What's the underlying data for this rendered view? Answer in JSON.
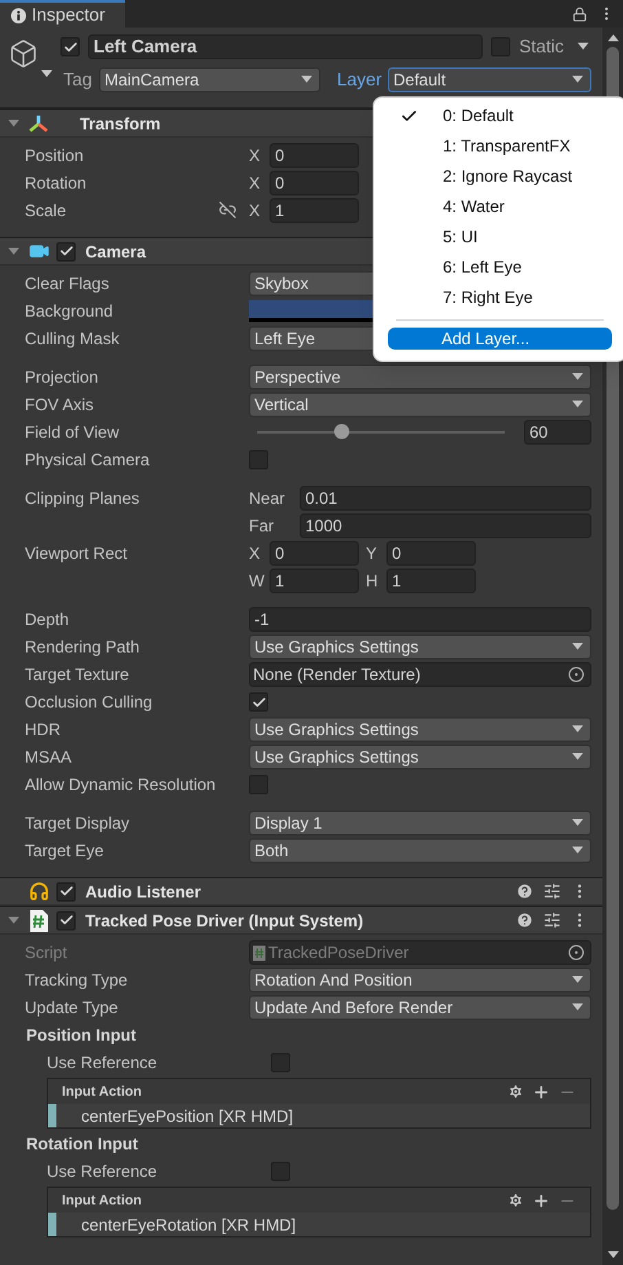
{
  "tab": {
    "title": "Inspector"
  },
  "object": {
    "active": true,
    "name": "Left Camera",
    "static": {
      "label": "Static",
      "checked": false
    },
    "tag": {
      "label": "Tag",
      "value": "MainCamera"
    },
    "layer": {
      "label": "Layer",
      "value": "Default"
    }
  },
  "components": [
    {
      "title": "Transform",
      "kind": "transform",
      "expanded": true,
      "tools": false,
      "groups": [
        [
          {
            "kind": "vector",
            "label": "Position",
            "axis": "X",
            "value": "0"
          },
          {
            "kind": "vector",
            "label": "Rotation",
            "axis": "X",
            "value": "0"
          },
          {
            "kind": "scale",
            "label": "Scale",
            "axis": "X",
            "value": "1"
          }
        ]
      ]
    },
    {
      "title": "Camera",
      "kind": "camera",
      "enabled": true,
      "expanded": true,
      "tools": false,
      "groups": [
        [
          {
            "kind": "partial_dropdown",
            "label": "Clear Flags",
            "value": "Skybox"
          },
          {
            "kind": "color",
            "label": "Background",
            "color": "#2f4b7c"
          },
          {
            "kind": "partial_dropdown",
            "label": "Culling Mask",
            "value": "Left Eye"
          }
        ],
        [
          {
            "kind": "dropdown",
            "label": "Projection",
            "value": "Perspective"
          },
          {
            "kind": "dropdown",
            "label": "FOV Axis",
            "value": "Vertical"
          },
          {
            "kind": "slider",
            "label": "Field of View",
            "level": 0.34,
            "value": "60"
          },
          {
            "kind": "checkbox",
            "label": "Physical Camera",
            "checked": false
          }
        ],
        [
          {
            "kind": "planes",
            "label": "Clipping Planes",
            "near_label": "Near",
            "near": "0.01",
            "far_label": "Far",
            "far": "1000"
          },
          {
            "kind": "rect",
            "label": "Viewport Rect",
            "fields": [
              {
                "label": "X",
                "value": "0"
              },
              {
                "label": "Y",
                "value": "0"
              },
              {
                "label": "W",
                "value": "1"
              },
              {
                "label": "H",
                "value": "1"
              }
            ]
          }
        ],
        [
          {
            "kind": "field",
            "label": "Depth",
            "value": "-1"
          },
          {
            "kind": "dropdown",
            "label": "Rendering Path",
            "value": "Use Graphics Settings"
          },
          {
            "kind": "object",
            "label": "Target Texture",
            "value": "None (Render Texture)",
            "disabled": false
          },
          {
            "kind": "checkbox",
            "label": "Occlusion Culling",
            "checked": true
          },
          {
            "kind": "dropdown",
            "label": "HDR",
            "value": "Use Graphics Settings"
          },
          {
            "kind": "dropdown",
            "label": "MSAA",
            "value": "Use Graphics Settings"
          },
          {
            "kind": "checkbox",
            "label": "Allow Dynamic Resolution",
            "checked": false
          }
        ],
        [
          {
            "kind": "dropdown",
            "label": "Target Display",
            "value": "Display 1"
          },
          {
            "kind": "dropdown",
            "label": "Target Eye",
            "value": "Both"
          }
        ]
      ]
    },
    {
      "title": "Audio Listener",
      "kind": "audio",
      "enabled": true,
      "tools": true
    },
    {
      "title": "Tracked Pose Driver (Input System)",
      "kind": "script",
      "enabled": true,
      "expanded": true,
      "tools": true,
      "groups": [
        [
          {
            "kind": "object",
            "label": "Script",
            "value": "TrackedPoseDriver",
            "disabled": true
          },
          {
            "kind": "dropdown",
            "label": "Tracking Type",
            "value": "Rotation And Position"
          },
          {
            "kind": "dropdown",
            "label": "Update Type",
            "value": "Update And Before Render"
          },
          {
            "kind": "section",
            "label": "Position Input"
          },
          {
            "kind": "subcheckbox",
            "label": "Use Reference",
            "checked": false
          },
          {
            "kind": "action",
            "title": "Input Action",
            "binding": "centerEyePosition [XR HMD]"
          },
          {
            "kind": "section",
            "label": "Rotation Input"
          },
          {
            "kind": "subcheckbox",
            "label": "Use Reference",
            "checked": false
          },
          {
            "kind": "action",
            "title": "Input Action",
            "binding": "centerEyeRotation [XR HMD]"
          }
        ]
      ]
    }
  ],
  "layer_menu": {
    "items": [
      {
        "label": "0: Default",
        "selected": true
      },
      {
        "label": "1: TransparentFX",
        "selected": false
      },
      {
        "label": "2: Ignore Raycast",
        "selected": false
      },
      {
        "label": "4: Water",
        "selected": false
      },
      {
        "label": "5: UI",
        "selected": false
      },
      {
        "label": "6: Left Eye",
        "selected": false
      },
      {
        "label": "7: Right Eye",
        "selected": false
      }
    ],
    "action": {
      "label": "Add Layer...",
      "highlighted": true
    }
  }
}
